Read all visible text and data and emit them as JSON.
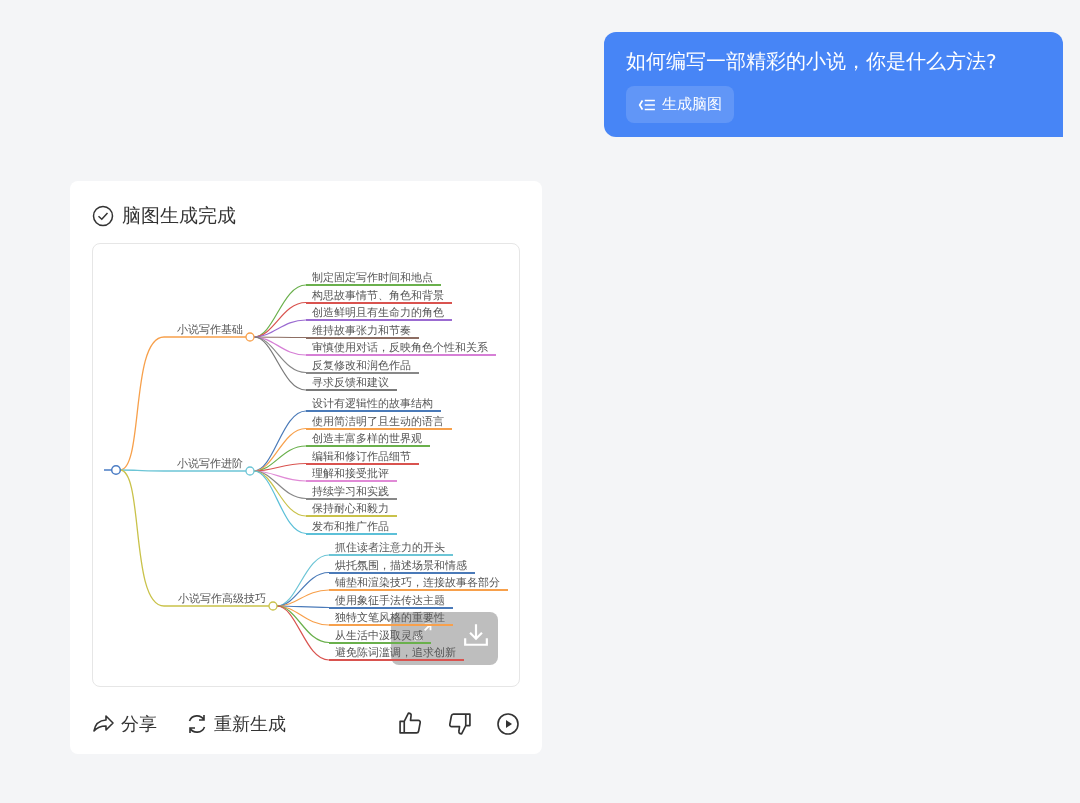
{
  "user_message": {
    "text": "如何编写一部精彩的小说，你是什么方法?",
    "button": "生成脑图"
  },
  "answer": {
    "status": "脑图生成完成",
    "mind_map": {
      "branches": [
        {
          "label": "小说写作基础",
          "color": "#f7a04b",
          "children": [
            {
              "label": "制定固定写作时间和地点",
              "color": "#6ab04c"
            },
            {
              "label": "构思故事情节、角色和背景",
              "color": "#d9534f"
            },
            {
              "label": "创造鲜明且有生命力的角色",
              "color": "#9b6bd1"
            },
            {
              "label": "维持故事张力和节奏",
              "color": "#8d6e63"
            },
            {
              "label": "审慎使用对话，反映角色个性和关系",
              "color": "#d67fd6"
            },
            {
              "label": "反复修改和润色作品",
              "color": "#888888"
            },
            {
              "label": "寻求反馈和建议",
              "color": "#7a7a7a"
            }
          ]
        },
        {
          "label": "小说写作进阶",
          "color": "#6cc5d6",
          "children": [
            {
              "label": "设计有逻辑性的故事结构",
              "color": "#4a7ab8"
            },
            {
              "label": "使用简洁明了且生动的语言",
              "color": "#f7a04b"
            },
            {
              "label": "创造丰富多样的世界观",
              "color": "#6ab04c"
            },
            {
              "label": "编辑和修订作品细节",
              "color": "#d9534f"
            },
            {
              "label": "理解和接受批评",
              "color": "#e08ad6"
            },
            {
              "label": "持续学习和实践",
              "color": "#888888"
            },
            {
              "label": "保持耐心和毅力",
              "color": "#c9c24a"
            },
            {
              "label": "发布和推广作品",
              "color": "#5cc0d8"
            }
          ]
        },
        {
          "label": "小说写作高级技巧",
          "color": "#c9c24a",
          "children": [
            {
              "label": "抓住读者注意力的开头",
              "color": "#6cc5d6"
            },
            {
              "label": "烘托氛围，描述场景和情感",
              "color": "#4a7ab8"
            },
            {
              "label": "铺垫和渲染技巧，连接故事各部分",
              "color": "#f7a04b"
            },
            {
              "label": "使用象征手法传达主题",
              "color": "#4a7ab9"
            },
            {
              "label": "独特文笔风格的重要性",
              "color": "#f7a04c"
            },
            {
              "label": "从生活中汲取灵感",
              "color": "#6ab04c"
            },
            {
              "label": "避免陈词滥调，追求创新",
              "color": "#d9534f"
            }
          ]
        }
      ]
    },
    "actions": [
      {
        "label": "分享",
        "kind": "share"
      },
      {
        "label": "重新生成",
        "kind": "regenerate"
      }
    ]
  }
}
